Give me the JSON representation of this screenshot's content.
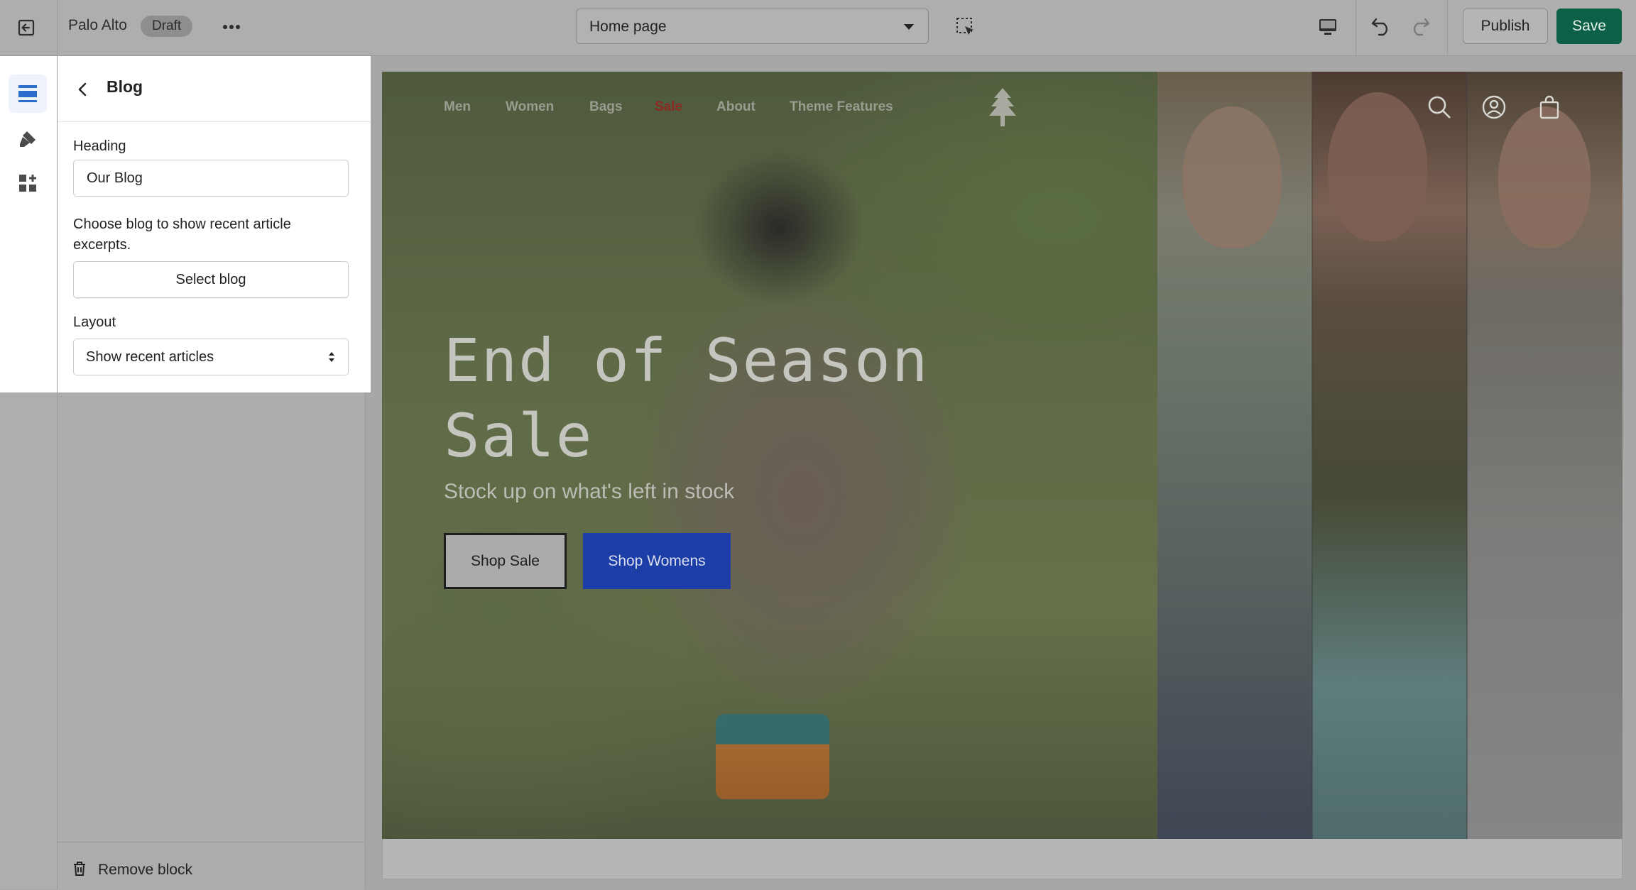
{
  "topbar": {
    "store_name": "Palo Alto",
    "status_badge": "Draft",
    "page_select_value": "Home page",
    "publish_label": "Publish",
    "save_label": "Save",
    "save_color": "#0c6047"
  },
  "rail": {
    "icons": [
      "sections-icon",
      "theme-settings-icon",
      "app-embeds-icon"
    ],
    "active": "sections-icon"
  },
  "panel": {
    "title": "Blog",
    "heading_label": "Heading",
    "heading_value": "Our Blog",
    "blog_help": "Choose blog to show recent article excerpts.",
    "select_blog_label": "Select blog",
    "layout_label": "Layout",
    "layout_value": "Show recent articles",
    "remove_label": "Remove block"
  },
  "preview": {
    "nav_items": [
      "Men",
      "Women",
      "Bags",
      "Sale",
      "About",
      "Theme Features"
    ],
    "sale_color": "#8d2a24",
    "hero_title": "End of Season Sale",
    "hero_subtitle": "Stock up on what's left in stock",
    "btn_shop_sale": "Shop Sale",
    "btn_shop_womens": "Shop Womens",
    "shop_womens_color": "#1d3ea7"
  }
}
